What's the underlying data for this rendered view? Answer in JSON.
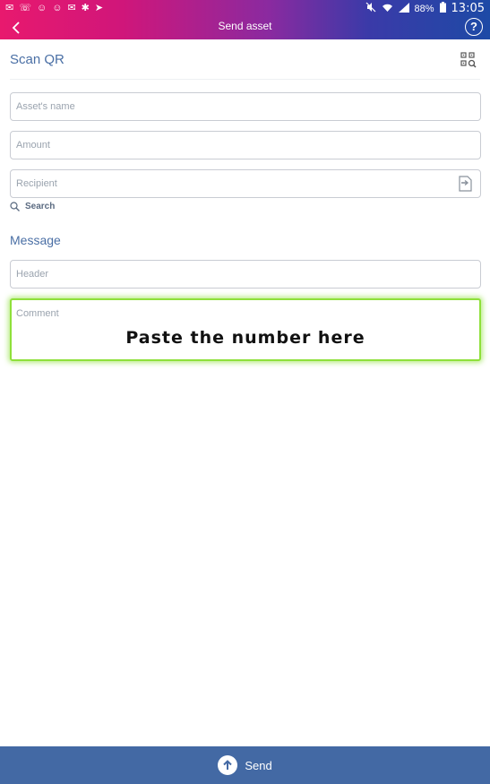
{
  "status_bar": {
    "left_icons": [
      "✉",
      "☏",
      "☺",
      "☺",
      "✉",
      "✱",
      "➤"
    ],
    "battery": "88%",
    "time": "13:05"
  },
  "app_bar": {
    "title": "Send asset",
    "help_icon_glyph": "?"
  },
  "scan": {
    "label": "Scan QR"
  },
  "fields": {
    "asset_name_placeholder": "Asset's name",
    "amount_placeholder": "Amount",
    "recipient_placeholder": "Recipient",
    "search_label": "Search"
  },
  "message": {
    "section_label": "Message",
    "header_placeholder": "Header",
    "comment_placeholder": "Comment",
    "overlay_text": "Paste the number here"
  },
  "bottom": {
    "send_label": "Send"
  },
  "colors": {
    "accent": "#4a6fa5",
    "bottom_bar": "#4369a4",
    "highlight": "#8ee03a"
  }
}
